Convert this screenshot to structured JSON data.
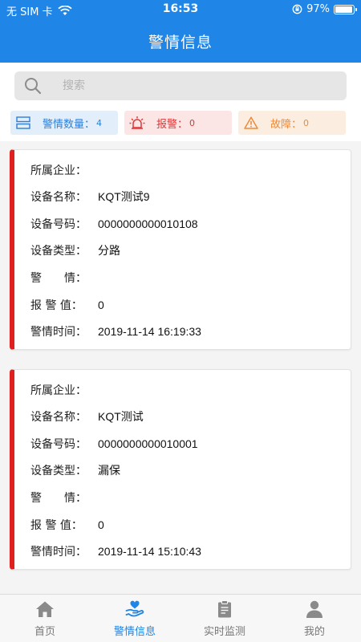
{
  "status_bar": {
    "carrier": "无 SIM 卡",
    "time": "16:53",
    "battery": "97%",
    "battery_level": 0.97
  },
  "header": {
    "title": "警情信息"
  },
  "search": {
    "placeholder": "搜索",
    "value": ""
  },
  "stats": {
    "alarm_info": {
      "label": "警情数量：",
      "count": "4",
      "color": "#2f7fd6"
    },
    "alarm": {
      "label": "报警：",
      "count": "0",
      "color": "#e03636"
    },
    "fault": {
      "label": "故障：",
      "count": "0",
      "color": "#ee8a3a"
    }
  },
  "cards": [
    {
      "rows": [
        {
          "label": "所属企业：",
          "value": ""
        },
        {
          "label": "设备名称：",
          "value": "KQT测试9"
        },
        {
          "label": "设备号码：",
          "value": "0000000000010108"
        },
        {
          "label": "设备类型：",
          "value": "分路"
        },
        {
          "label": "警　　情：",
          "value": ""
        },
        {
          "label": "报 警 值：",
          "value": "0"
        },
        {
          "label": "警情时间：",
          "value": "2019-11-14 16:19:33"
        }
      ]
    },
    {
      "rows": [
        {
          "label": "所属企业：",
          "value": ""
        },
        {
          "label": "设备名称：",
          "value": "KQT测试"
        },
        {
          "label": "设备号码：",
          "value": "0000000000010001"
        },
        {
          "label": "设备类型：",
          "value": "漏保"
        },
        {
          "label": "警　　情：",
          "value": ""
        },
        {
          "label": "报 警 值：",
          "value": "0"
        },
        {
          "label": "警情时间：",
          "value": "2019-11-14 15:10:43"
        }
      ]
    }
  ],
  "tabbar": {
    "items": [
      {
        "label": "首页",
        "icon": "home-icon"
      },
      {
        "label": "警情信息",
        "icon": "alarm-info-icon",
        "active": true
      },
      {
        "label": "实时监测",
        "icon": "clipboard-icon"
      },
      {
        "label": "我的",
        "icon": "user-icon"
      }
    ]
  },
  "colors": {
    "primary": "#1f85e6",
    "alert_border": "#e01f1f"
  }
}
